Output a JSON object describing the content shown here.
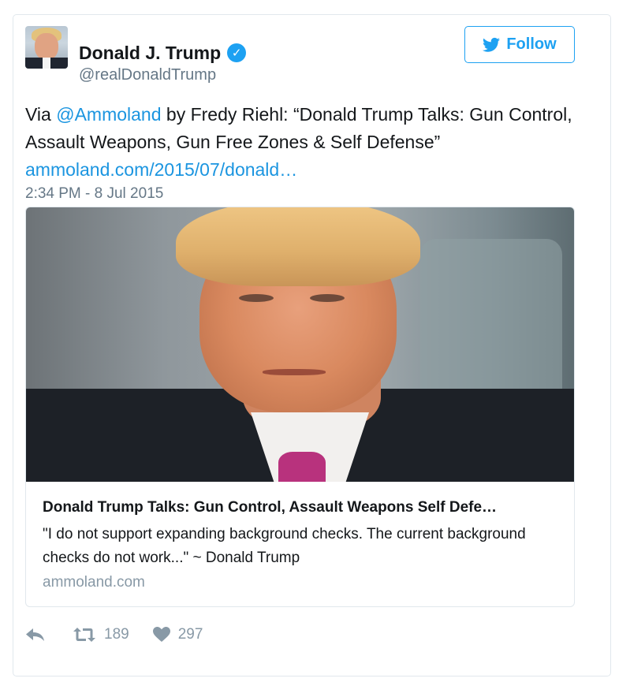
{
  "author": {
    "name": "Donald J. Trump",
    "handle": "@realDonaldTrump",
    "verified_icon": "checkmark-icon"
  },
  "follow_button": {
    "label": "Follow",
    "icon": "twitter-bird-icon",
    "color": "#1da1f2"
  },
  "tweet": {
    "prefix": "Via ",
    "mention": "@Ammoland",
    "body": " by Fredy Riehl: “Donald Trump Talks: Gun Control, Assault Weapons, Gun Free Zones & Self Defense”",
    "link": "ammoland.com/2015/07/donald…",
    "timestamp": "2:34 PM - 8 Jul 2015"
  },
  "card": {
    "title": "Donald Trump Talks: Gun Control, Assault Weapons Self Defe…",
    "description": "\"I do not support expanding background checks. The current background checks do not work...\" ~ Donald Trump",
    "domain": "ammoland.com"
  },
  "actions": {
    "reply_icon": "reply-icon",
    "retweet_icon": "retweet-icon",
    "retweet_count": "189",
    "like_icon": "heart-icon",
    "like_count": "297"
  },
  "colors": {
    "link": "#1b95e0",
    "muted": "#657786",
    "border": "#e1e8ed"
  }
}
